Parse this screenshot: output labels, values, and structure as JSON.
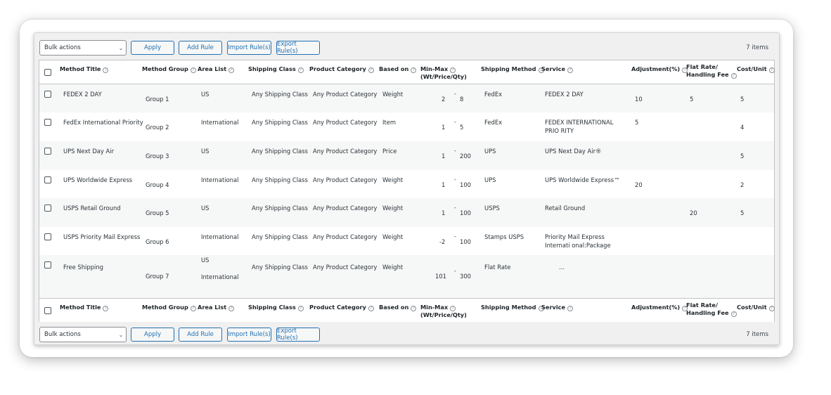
{
  "toolbar": {
    "bulk_actions": "Bulk actions",
    "apply": "Apply",
    "add_rule": "Add Rule",
    "import_rules": "Import Rule(s)",
    "export_rules": "Export Rule(s)",
    "items_count": "7 items"
  },
  "columns": {
    "method_title": "Method Title",
    "method_group": "Method Group",
    "area_list": "Area List",
    "shipping_class": "Shipping Class",
    "product_category": "Product Category",
    "based_on": "Based on",
    "min_max_1": "Min-Max",
    "min_max_2": "(Wt/Price/Qty)",
    "shipping_method": "Shipping Method",
    "service": "Service",
    "adjustment": "Adjustment(%)",
    "flat_rate_1": "Flat Rate/",
    "flat_rate_2": "Handling Fee",
    "cost_unit": "Cost/Unit"
  },
  "help_glyph": "?",
  "rows": [
    {
      "title": "FEDEX 2 DAY",
      "group": "Group 1",
      "area": "US",
      "area2": "",
      "class": "Any Shipping Class",
      "category": "Any Product Category",
      "based": "Weight",
      "min": "2",
      "max": "8",
      "method": "FedEx",
      "service": "FEDEX 2 DAY",
      "adjustment": "10",
      "flat": "5",
      "cost": "5"
    },
    {
      "title": "FedEx International Priority",
      "group": "Group 2",
      "area": "International",
      "area2": "",
      "class": "Any Shipping Class",
      "category": "Any Product Category",
      "based": "Item",
      "min": "1",
      "max": "5",
      "method": "FedEx",
      "service": "FEDEX INTERNATIONAL PRIO RITY",
      "adjustment": "5",
      "flat": "",
      "cost": "4"
    },
    {
      "title": "UPS Next Day Air",
      "group": "Group 3",
      "area": "US",
      "area2": "",
      "class": "Any Shipping Class",
      "category": "Any Product Category",
      "based": "Price",
      "min": "1",
      "max": "200",
      "method": "UPS",
      "service": "UPS Next Day Air®",
      "adjustment": "",
      "flat": "",
      "cost": "5"
    },
    {
      "title": "UPS Worldwide Express",
      "group": "Group 4",
      "area": "International",
      "area2": "",
      "class": "Any Shipping Class",
      "category": "Any Product Category",
      "based": "Weight",
      "min": "1",
      "max": "100",
      "method": "UPS",
      "service": "UPS Worldwide Express™",
      "adjustment": "20",
      "flat": "",
      "cost": "2"
    },
    {
      "title": "USPS Retail Ground",
      "group": "Group 5",
      "area": "US",
      "area2": "",
      "class": "Any Shipping Class",
      "category": "Any Product Category",
      "based": "Weight",
      "min": "1",
      "max": "100",
      "method": "USPS",
      "service": "Retail Ground",
      "adjustment": "",
      "flat": "20",
      "cost": "5"
    },
    {
      "title": "USPS Priority Mail Express",
      "group": "Group 6",
      "area": "International",
      "area2": "",
      "class": "Any Shipping Class",
      "category": "Any Product Category",
      "based": "Weight",
      "min": "-2",
      "max": "100",
      "method": "Stamps USPS",
      "service": "Priority Mail Express Internati onal:Package",
      "adjustment": "",
      "flat": "",
      "cost": ""
    },
    {
      "title": "Free Shipping",
      "group": "Group 7",
      "area": "US",
      "area2": "International",
      "class": "Any Shipping Class",
      "category": "Any Product Category",
      "based": "Weight",
      "min": "101",
      "max": "300",
      "method": "Flat Rate",
      "service": "...",
      "adjustment": "",
      "flat": "",
      "cost": ""
    }
  ],
  "range_dash": "-"
}
